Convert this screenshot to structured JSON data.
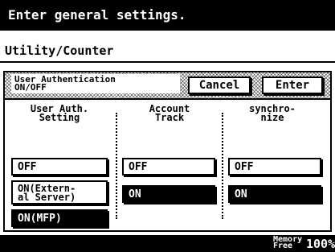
{
  "header": {
    "instruction": "Enter general settings."
  },
  "breadcrumb": {
    "title": "Utility/Counter"
  },
  "panel": {
    "label_line1": "User Authentication",
    "label_line2": "ON/OFF",
    "cancel_label": "Cancel",
    "enter_label": "Enter"
  },
  "columns": {
    "user_auth": {
      "head_line1": "User Auth.",
      "head_line2": "Setting",
      "options": {
        "off": "OFF",
        "on_external_line1": "ON(Extern-",
        "on_external_line2": "al Server)",
        "on_mfp": "ON(MFP)"
      },
      "selected": "ON(MFP)"
    },
    "account_track": {
      "head_line1": "Account",
      "head_line2": "Track",
      "options": {
        "off": "OFF",
        "on": "ON"
      },
      "selected": "ON"
    },
    "synchronize": {
      "head_line1": "synchro-",
      "head_line2": "nize",
      "options": {
        "off": "OFF",
        "on": "ON"
      },
      "selected": "ON"
    }
  },
  "footer": {
    "memory_label_line1": "Memory",
    "memory_label_line2": "Free",
    "memory_value": "100%"
  }
}
